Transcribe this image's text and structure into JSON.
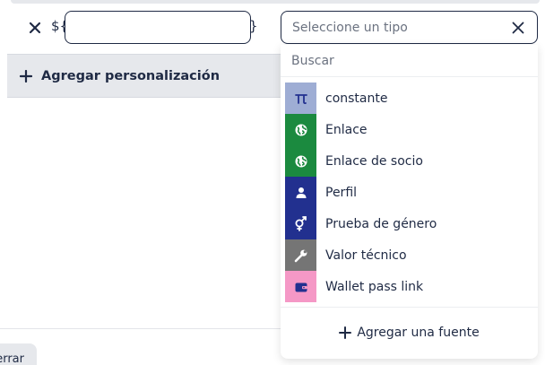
{
  "row": {
    "var_prefix": "${",
    "var_suffix": "}",
    "var_value": "",
    "remove_icon": "close-icon"
  },
  "type_select": {
    "placeholder": "Seleccione un tipo",
    "clear_icon": "close-icon"
  },
  "add_customization": {
    "label": "Agregar personalización",
    "icon": "plus-icon"
  },
  "footer": {
    "close_label": "errar"
  },
  "dropdown": {
    "search_placeholder": "Buscar",
    "items": [
      {
        "label": "constante",
        "icon": "pi-icon",
        "color": "#9eadd4"
      },
      {
        "label": "Enlace",
        "icon": "globe-icon",
        "color": "#1b8a3f"
      },
      {
        "label": "Enlace de socio",
        "icon": "globe-icon",
        "color": "#1b8a3f"
      },
      {
        "label": "Perfil",
        "icon": "person-icon",
        "color": "#22308f"
      },
      {
        "label": "Prueba de género",
        "icon": "gender-icon",
        "color": "#22308f"
      },
      {
        "label": "Valor técnico",
        "icon": "wrench-icon",
        "color": "#757575"
      },
      {
        "label": "Wallet pass link",
        "icon": "wallet-icon",
        "color": "#f598c6"
      }
    ],
    "add_source_label": "Agregar una fuente"
  }
}
